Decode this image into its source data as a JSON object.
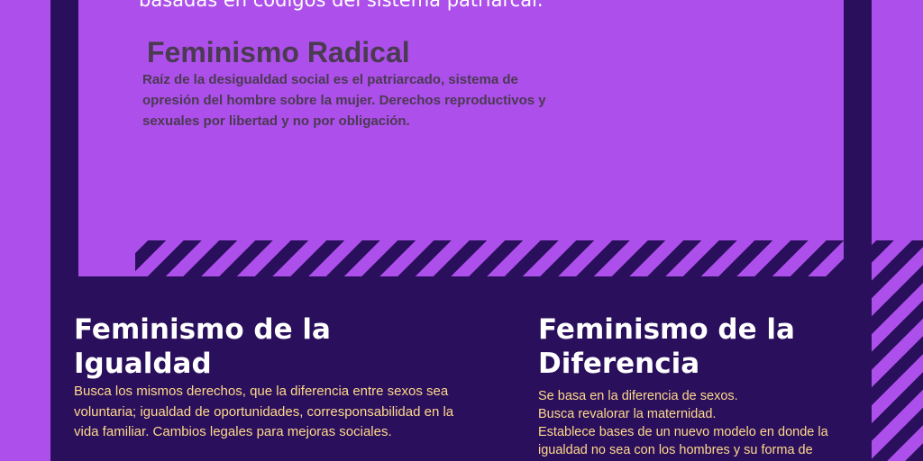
{
  "colors": {
    "background": "#ad4fea",
    "dark_frame": "#2a0f5c",
    "radical_text": "#4a3a52",
    "heading_text": "#ffffff",
    "body_text": "#ffd98a"
  },
  "top": {
    "cut_line": "basadas en códigos del sistema patriarcal."
  },
  "radical": {
    "title": "Feminismo Radical",
    "body": "Raíz de la desigualdad social es el patriarcado, sistema de opresión del hombre sobre la mujer. Derechos reproductivos y sexuales por libertad y no por obligación."
  },
  "igualdad": {
    "title": "Feminismo de la Igualdad",
    "body": "Busca los mismos derechos, que la diferencia entre sexos sea voluntaria; igualdad de oportunidades, corresponsabilidad en la vida familiar. Cambios legales para mejoras sociales."
  },
  "diferencia": {
    "title": "Feminismo de la Diferencia",
    "lines": [
      "Se basa en la diferencia de sexos.",
      "Busca revalorar la maternidad.",
      "Establece bases de un nuevo modelo en donde la igualdad no sea con los hombres y su forma de"
    ]
  }
}
